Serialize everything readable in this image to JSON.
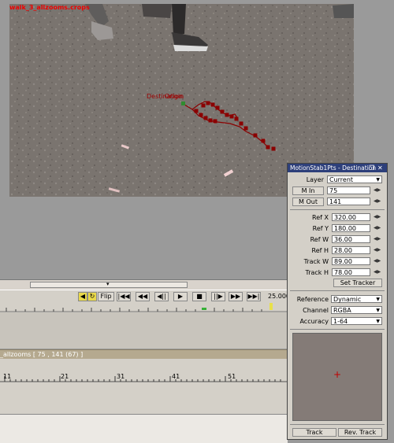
{
  "viewer": {
    "clip_label": "walk_3_allzooms.crops",
    "annotation_destination": "Destination",
    "annotation_origin": "Origin"
  },
  "transport": {
    "flip_label": "Flip",
    "fps": "25.000"
  },
  "timeline": {
    "clip_label": "_allzooms [ 75 , 141  (67) ]",
    "ruler_ticks": [
      "11",
      "21",
      "31",
      "41",
      "51"
    ]
  },
  "panel": {
    "title": "MotionStab1Pts - Destination",
    "layer_label": "Layer",
    "layer_value": "Current",
    "m_in_label": "M In",
    "m_in_value": "75",
    "m_out_label": "M Out",
    "m_out_value": "141",
    "refx_label": "Ref X",
    "refx_value": "320.00",
    "refy_label": "Ref Y",
    "refy_value": "180.00",
    "refw_label": "Ref W",
    "refw_value": "36.00",
    "refh_label": "Ref H",
    "refh_value": "28.00",
    "trackw_label": "Track W",
    "trackw_value": "89.00",
    "trackh_label": "Track H",
    "trackh_value": "78.00",
    "set_tracker_label": "Set Tracker",
    "reference_label": "Reference",
    "reference_value": "Dynamic",
    "channel_label": "Channel",
    "channel_value": "RGBA",
    "accuracy_label": "Accuracy",
    "accuracy_value": "1-64",
    "track_label": "Track",
    "rev_track_label": "Rev. Track"
  },
  "colors": {
    "title_bar": "#2d3f7a",
    "track_marks": "#8b0000",
    "clip_label": "#ee0000"
  }
}
